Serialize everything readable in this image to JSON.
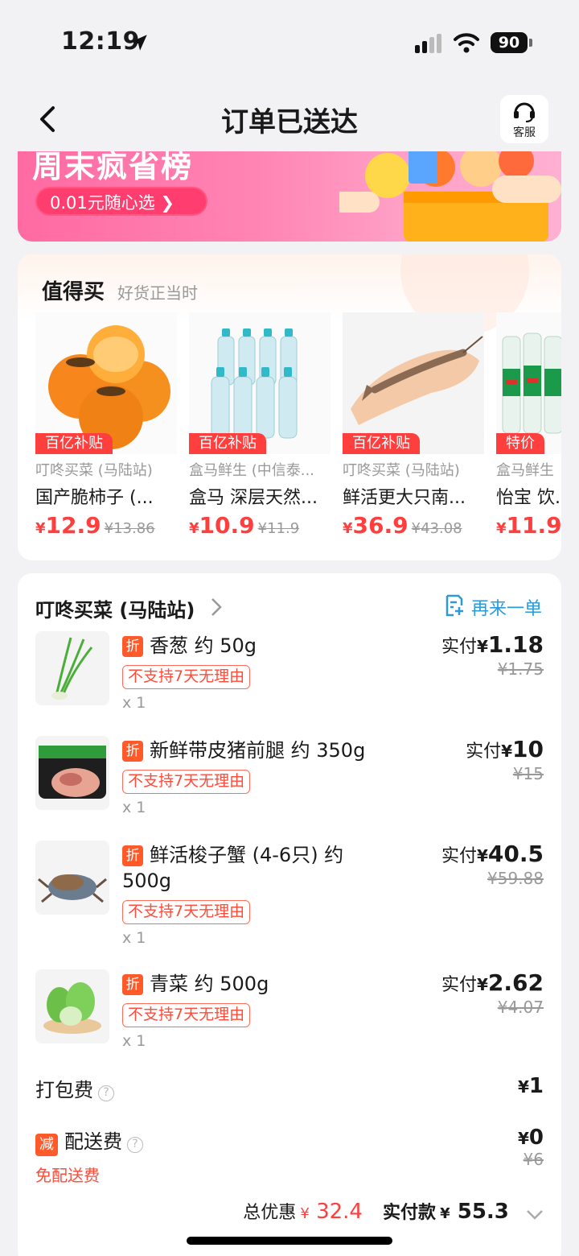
{
  "status_bar": {
    "time": "12:19",
    "battery": "90"
  },
  "nav": {
    "title": "订单已送达",
    "service_label": "客服"
  },
  "banner": {
    "title": "周末疯省榜",
    "button_label": "0.01元随心选 ❯"
  },
  "recommend": {
    "title": "值得买",
    "subtitle": "好货正当时",
    "products": [
      {
        "tag": "百亿补贴",
        "store": "叮咚买菜 (马陆站)",
        "name": "国产脆柿子 (...",
        "currency": "¥",
        "price": "12.9",
        "old_price": "¥13.86"
      },
      {
        "tag": "百亿补贴",
        "store": "盒马鲜生 (中信泰...",
        "name": "盒马 深层天然...",
        "currency": "¥",
        "price": "10.9",
        "old_price": "¥11.9"
      },
      {
        "tag": "百亿补贴",
        "store": "叮咚买菜 (马陆站)",
        "name": "鲜活更大只南...",
        "currency": "¥",
        "price": "36.9",
        "old_price": "¥43.08"
      },
      {
        "tag": "特价",
        "store": "盒马鲜生",
        "name": "怡宝 饮...",
        "currency": "¥",
        "price": "11.9",
        "old_price": ""
      }
    ]
  },
  "order": {
    "store_name": "叮咚买菜 (马陆站)",
    "reorder_label": "再来一单",
    "items": [
      {
        "badge": "折",
        "name": "香葱 约 50g",
        "policy": "不支持7天无理由",
        "qty": "x 1",
        "pay_label": "实付",
        "pay_currency": "¥",
        "pay_value": "1.18",
        "old_price": "¥1.75"
      },
      {
        "badge": "折",
        "name": "新鲜带皮猪前腿 约 350g",
        "policy": "不支持7天无理由",
        "qty": "x 1",
        "pay_label": "实付",
        "pay_currency": "¥",
        "pay_value": "10",
        "old_price": "¥15"
      },
      {
        "badge": "折",
        "name": "鲜活梭子蟹 (4-6只) 约 500g",
        "policy": "不支持7天无理由",
        "qty": "x 1",
        "pay_label": "实付",
        "pay_currency": "¥",
        "pay_value": "40.5",
        "old_price": "¥59.88"
      },
      {
        "badge": "折",
        "name": "青菜 约 500g",
        "policy": "不支持7天无理由",
        "qty": "x 1",
        "pay_label": "实付",
        "pay_currency": "¥",
        "pay_value": "2.62",
        "old_price": "¥4.07"
      }
    ],
    "packing_fee": {
      "label": "打包费",
      "currency": "¥",
      "value": "1"
    },
    "delivery_fee": {
      "badge": "减",
      "label": "配送费",
      "currency": "¥",
      "value": "0",
      "old_value": "¥6",
      "note": "免配送费"
    },
    "total": {
      "discount_label": "总优惠",
      "discount_currency": "¥",
      "discount_value": "32.4",
      "pay_label": "实付款",
      "pay_currency": "¥",
      "pay_value": "55.3"
    }
  },
  "colors": {
    "accent_red": "#ff3e3e",
    "link_blue": "#2a9bd8",
    "badge_orange": "#ff5a2a",
    "banner_pink": "#ff85b4"
  }
}
